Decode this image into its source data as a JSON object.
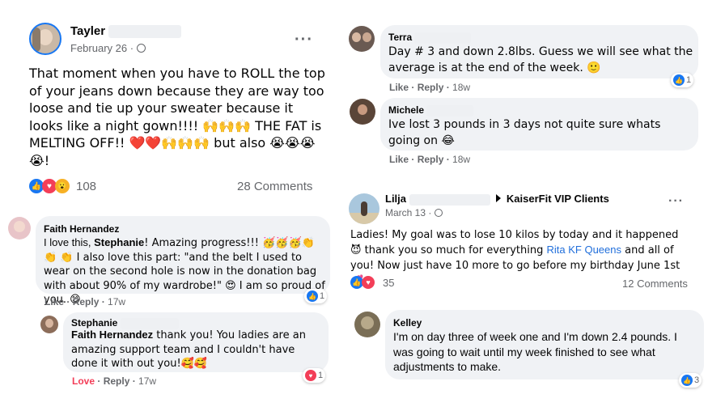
{
  "post1": {
    "author": "Tayler",
    "date": "February 26 · ",
    "text": "That moment when you have to ROLL the top of your jeans down because they are way too loose and tie up your sweater because it looks like a night gown!!!! 🙌🙌🙌 THE FAT is MELTING OFF!! ❤️❤️🙌🙌🙌 but also 😭😭😭😭!",
    "reaction_count": "108",
    "comments_label": "28 Comments"
  },
  "comment_faith": {
    "name": "Faith Hernandez",
    "text_a": "I love this, ",
    "text_b": "Stephanie",
    "text_c": "! Amazing progress!!! 🥳🥳🥳👏👏 👏 I also love this part: \"and the belt I used to wear on the second hole is now in the donation bag with about 90% of my wardrobe!\" 😍 I am so proud of you. 😊",
    "like": "Like",
    "reply": "Reply",
    "time": "17w",
    "reactions": "1"
  },
  "reply_stephanie": {
    "name": "Stephanie",
    "mention": "Faith Hernandez",
    "text": " thank you! You ladies are an amazing support team and I couldn't have done it with out you!🥰🥰",
    "love": "Love",
    "reply": "Reply",
    "time": "17w",
    "reactions": "1"
  },
  "comment_terra": {
    "name": "Terra",
    "text": "Day # 3 and down 2.8lbs. Guess we will see what the average is at the end of the week. 🙂",
    "like": "Like",
    "reply": "Reply",
    "time": "18w",
    "reactions": "1"
  },
  "comment_michele": {
    "name": "Michele",
    "text": "Ive lost 3 pounds in 3 days not quite sure whats going on 😂",
    "like": "Like",
    "reply": "Reply",
    "time": "18w"
  },
  "post2": {
    "author": "Lilja",
    "group": "KaiserFit VIP Clients",
    "date": "March 13 · ",
    "text_a": "Ladies! My goal was to lose 10 kilos by today and it happened 😈 thank you so much for everything ",
    "link": "Rita KF Queens",
    "text_b": " and all of you! Now just have 10 more to go before my birthday June 1st 💕",
    "reaction_count": "35",
    "comments_label": "12 Comments"
  },
  "comment_kelley": {
    "name": "Kelley",
    "text": "I'm on day three of week one and I'm down 2.4 pounds. I was going to wait until my week finished to see what adjustments to make.",
    "reactions": "3"
  },
  "icons": {
    "more": "more-options-icon",
    "globe": "globe-icon",
    "like": "like-reaction-icon",
    "love": "love-reaction-icon",
    "wow": "wow-reaction-icon",
    "caret": "caret-right-icon"
  },
  "colors": {
    "brand_blue": "#1877f2",
    "love_red": "#f33e58",
    "bubble_gray": "#f0f2f5",
    "secondary_text": "#65676b"
  }
}
